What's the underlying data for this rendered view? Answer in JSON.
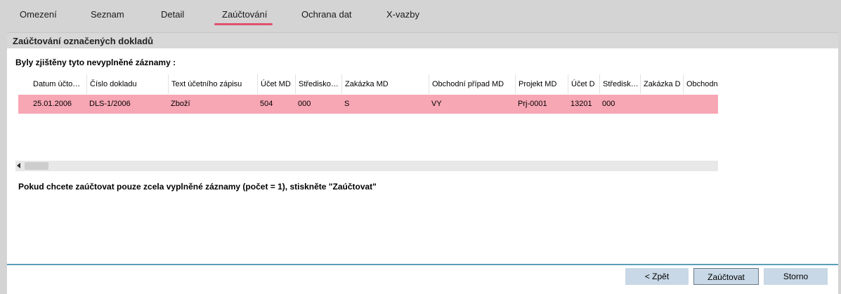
{
  "tabs": [
    {
      "label": "Omezení",
      "active": false
    },
    {
      "label": "Seznam",
      "active": false
    },
    {
      "label": "Detail",
      "active": false
    },
    {
      "label": "Zaúčtování",
      "active": true
    },
    {
      "label": "Ochrana dat",
      "active": false
    },
    {
      "label": "X-vazby",
      "active": false
    }
  ],
  "panel": {
    "title": "Zaúčtování označených dokladů",
    "info": "Byly zjištěny tyto nevyplněné záznamy :",
    "hint": "Pokud chcete zaúčtovat pouze zcela vyplněné záznamy (počet = 1), stiskněte \"Zaúčtovat\""
  },
  "grid": {
    "columns": [
      "Datum účto…",
      "Číslo dokladu",
      "Text účetního zápisu",
      "Účet MD",
      "Středisko…",
      "Zakázka MD",
      "Obchodní případ MD",
      "Projekt MD",
      "Účet D",
      "Středisk…",
      "Zakázka D",
      "Obchodní"
    ],
    "rows": [
      [
        "25.01.2006",
        "DLS-1/2006",
        "Zboží",
        "504",
        "000",
        "S",
        "VY",
        "Prj-0001",
        "13201",
        "000",
        "",
        ""
      ]
    ],
    "selected_row_color": "#f7a6b4"
  },
  "buttons": {
    "back": "< Zpět",
    "post": "Zaúčtovat",
    "cancel": "Storno"
  },
  "colors": {
    "accent": "#e0506e",
    "divider": "#5aa0b8"
  }
}
